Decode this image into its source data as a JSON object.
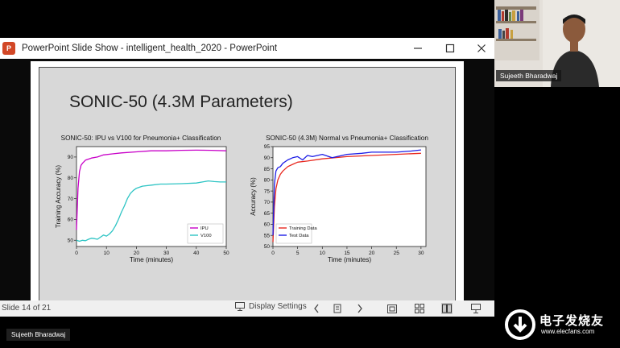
{
  "window": {
    "title": "PowerPoint Slide Show  -  intelligent_health_2020 - PowerPoint",
    "app_icon": "P",
    "minimize_icon": "minimize-icon",
    "maximize_icon": "maximize-icon",
    "close_icon": "close-icon"
  },
  "slide": {
    "title": "SONIC-50 (4.3M Parameters)"
  },
  "status_bar": {
    "slide_counter": "Slide 14 of 21",
    "display_settings": "Display Settings"
  },
  "webcam": {
    "name": "Sujeeth Bharadwaj"
  },
  "bottom_name": "Sujeeth Bharadwaj",
  "watermark": {
    "cn": "电子发烧友",
    "url": "www.elecfans.com"
  },
  "chart_data": [
    {
      "type": "line",
      "title": "SONIC-50: IPU vs V100 for Pneumonia+ Classification",
      "xlabel": "Time (minutes)",
      "ylabel": "Training Accuracy (%)",
      "xlim": [
        0,
        50
      ],
      "ylim": [
        47,
        95
      ],
      "xticks": [
        0,
        10,
        20,
        30,
        40,
        50
      ],
      "yticks": [
        50,
        60,
        70,
        80,
        90
      ],
      "legend_position": "bottom-right",
      "series": [
        {
          "name": "IPU",
          "color": "#c800c8",
          "x": [
            0,
            0.5,
            1,
            1.5,
            2,
            3,
            4,
            5,
            7,
            9,
            12,
            15,
            20,
            25,
            30,
            35,
            40,
            45,
            50
          ],
          "y": [
            55,
            75,
            83,
            86,
            87,
            88.5,
            89,
            89.5,
            90,
            91,
            91.5,
            92,
            92.5,
            93,
            93,
            93.2,
            93.3,
            93.2,
            93
          ]
        },
        {
          "name": "V100",
          "color": "#2ec4c4",
          "x": [
            0,
            1,
            2,
            3,
            4,
            5,
            6,
            7,
            8,
            9,
            10,
            11,
            12,
            13,
            14,
            15,
            16,
            17,
            18,
            19,
            20,
            22,
            25,
            28,
            30,
            35,
            40,
            44,
            46,
            48,
            50
          ],
          "y": [
            50,
            49.5,
            50,
            49.8,
            50.5,
            51,
            50.8,
            50.5,
            51.5,
            52.5,
            52,
            53,
            54.5,
            57,
            60,
            63.5,
            66.5,
            70,
            72.5,
            74,
            75,
            76,
            76.5,
            77,
            77,
            77.2,
            77.5,
            78.5,
            78.2,
            78,
            78
          ]
        }
      ]
    },
    {
      "type": "line",
      "title": "SONIC-50 (4.3M) Normal vs Pneumonia+ Classification",
      "xlabel": "Time (minutes)",
      "ylabel": "Accuracy (%)",
      "xlim": [
        0,
        31
      ],
      "ylim": [
        50,
        95
      ],
      "xticks": [
        0,
        5,
        10,
        15,
        20,
        25,
        30
      ],
      "yticks": [
        50,
        55,
        60,
        65,
        70,
        75,
        80,
        85,
        90,
        95
      ],
      "legend_position": "bottom-left",
      "series": [
        {
          "name": "Training Data",
          "color": "#e8281e",
          "x": [
            0,
            0.3,
            0.6,
            1,
            1.5,
            2,
            3,
            4,
            5,
            7,
            10,
            15,
            20,
            25,
            30
          ],
          "y": [
            52,
            68,
            76,
            80,
            82.5,
            84,
            86,
            87,
            88,
            88.5,
            89.5,
            90.5,
            91,
            91.5,
            92
          ]
        },
        {
          "name": "Test Data",
          "color": "#1e1ee6",
          "x": [
            0,
            0.3,
            0.6,
            1,
            1.5,
            2,
            3,
            4,
            5,
            6,
            7,
            8,
            10,
            12,
            15,
            18,
            20,
            25,
            28,
            30
          ],
          "y": [
            55,
            78,
            84,
            85.5,
            86,
            87.5,
            89,
            90,
            90.5,
            89,
            91,
            90.5,
            91.5,
            90,
            91.5,
            92,
            92.5,
            92.5,
            93,
            93.5
          ]
        }
      ]
    }
  ]
}
